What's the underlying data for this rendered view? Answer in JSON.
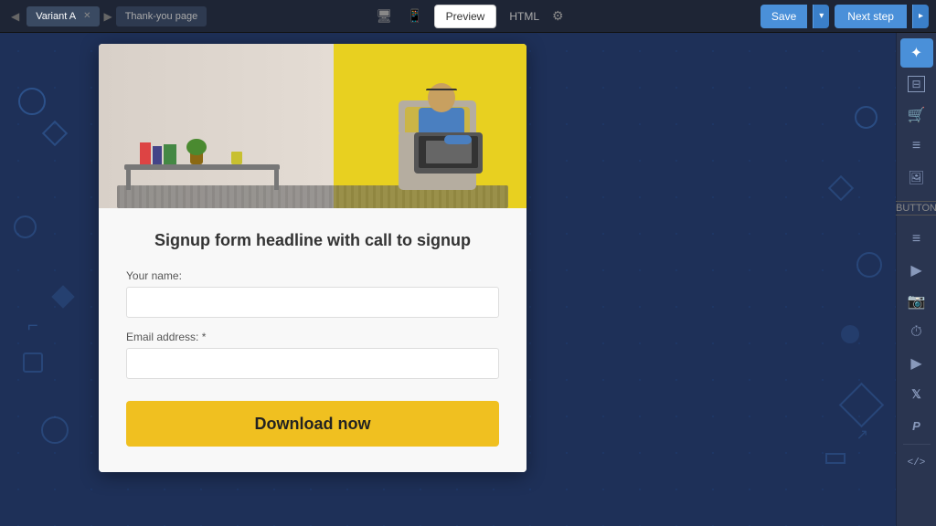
{
  "toolbar": {
    "variant_tab": "Variant A",
    "thankyou_tab": "Thank-you page",
    "preview_label": "Preview",
    "html_label": "HTML",
    "save_label": "Save",
    "save_arrow": "▾",
    "next_step_label": "Next step",
    "next_step_arrow": "▸"
  },
  "form": {
    "headline": "Signup form headline with call to signup",
    "name_label": "Your name:",
    "email_label": "Email address: *",
    "name_placeholder": "",
    "email_placeholder": "",
    "button_label": "Download now"
  },
  "sidebar_icons": [
    {
      "name": "magic-wand-icon",
      "symbol": "✦",
      "active": true
    },
    {
      "name": "sections-icon",
      "symbol": "⊟"
    },
    {
      "name": "cart-icon",
      "symbol": "🛒"
    },
    {
      "name": "text-icon",
      "symbol": "≡"
    },
    {
      "name": "image-icon",
      "symbol": "▣"
    },
    {
      "name": "button-icon",
      "symbol": "BUTTON",
      "small": true
    },
    {
      "name": "divider-icon",
      "symbol": "—"
    },
    {
      "name": "video-icon",
      "symbol": "▶"
    },
    {
      "name": "form-icon",
      "symbol": "◉"
    },
    {
      "name": "timer-icon",
      "symbol": "⏱"
    },
    {
      "name": "play-icon",
      "symbol": "▶"
    },
    {
      "name": "twitter-icon",
      "symbol": "𝕏"
    },
    {
      "name": "paypal-icon",
      "symbol": "Ᵽ"
    },
    {
      "name": "code-icon",
      "symbol": "</>"
    }
  ]
}
